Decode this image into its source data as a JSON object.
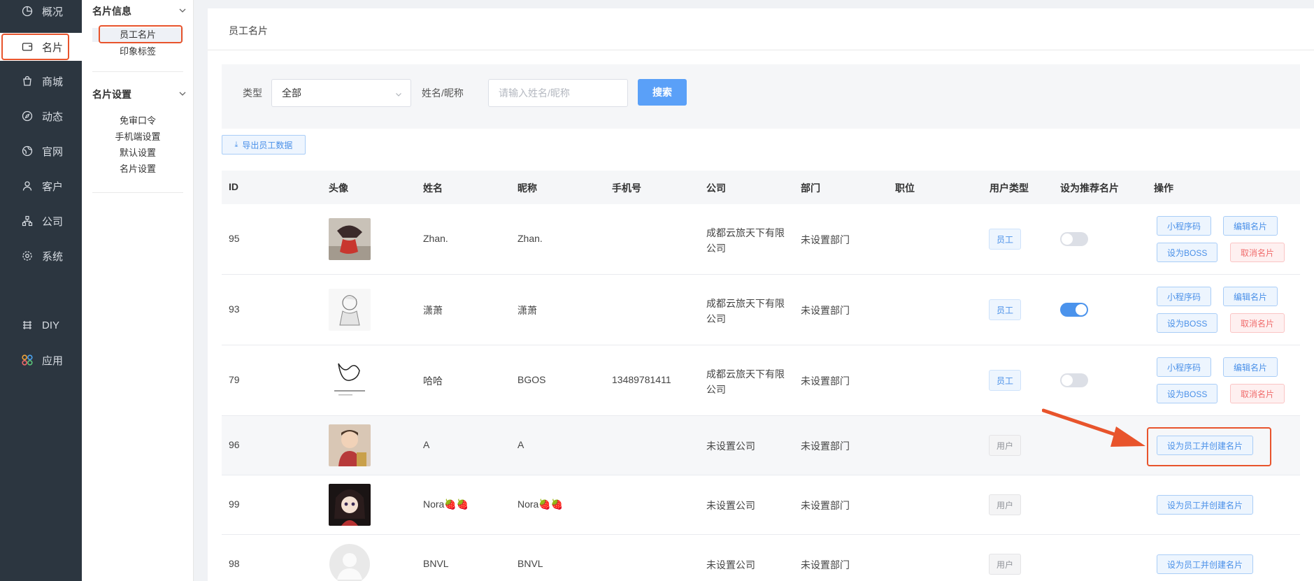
{
  "sidebar": {
    "items": [
      {
        "label": "概况",
        "icon": "pie-chart-icon"
      },
      {
        "label": "名片",
        "icon": "card-icon"
      },
      {
        "label": "商城",
        "icon": "shopping-bag-icon"
      },
      {
        "label": "动态",
        "icon": "compass-icon"
      },
      {
        "label": "官网",
        "icon": "globe-icon"
      },
      {
        "label": "客户",
        "icon": "user-icon"
      },
      {
        "label": "公司",
        "icon": "org-chart-icon"
      },
      {
        "label": "系统",
        "icon": "gear-icon"
      },
      {
        "label": "DIY",
        "icon": "layers-icon"
      },
      {
        "label": "应用",
        "icon": "apps-grid-icon"
      }
    ],
    "active": "名片"
  },
  "submenu": {
    "section1": {
      "title": "名片信息",
      "items": [
        "员工名片",
        "印象标签"
      ]
    },
    "section2": {
      "title": "名片设置",
      "items": [
        "免审口令",
        "手机端设置",
        "默认设置",
        "名片设置"
      ]
    },
    "active": "员工名片"
  },
  "page": {
    "title": "员工名片"
  },
  "filter": {
    "type_label": "类型",
    "type_value": "全部",
    "name_label": "姓名/昵称",
    "name_placeholder": "请输入姓名/昵称",
    "search_label": "搜索"
  },
  "export_label": "导出员工数据",
  "table": {
    "headers": [
      "ID",
      "头像",
      "姓名",
      "昵称",
      "手机号",
      "公司",
      "部门",
      "职位",
      "用户类型",
      "设为推荐名片",
      "操作"
    ],
    "rows": [
      {
        "id": "95",
        "name": "Zhan.",
        "nickname": "Zhan.",
        "phone": "",
        "company": "成都云旅天下有限公司",
        "company_l1": "成都云旅天下有限",
        "company_l2": "公司",
        "dept": "未设置部门",
        "position": "",
        "type": "员工",
        "recommend": false,
        "actions": [
          "小程序码",
          "编辑名片",
          "设为BOSS",
          "取消名片"
        ]
      },
      {
        "id": "93",
        "name": "潇萧",
        "nickname": "潇萧",
        "phone": "",
        "company": "成都云旅天下有限公司",
        "company_l1": "成都云旅天下有限",
        "company_l2": "公司",
        "dept": "未设置部门",
        "position": "",
        "type": "员工",
        "recommend": true,
        "actions": [
          "小程序码",
          "编辑名片",
          "设为BOSS",
          "取消名片"
        ]
      },
      {
        "id": "79",
        "name": "哈哈",
        "nickname": "BGOS",
        "phone": "13489781411",
        "company": "成都云旅天下有限公司",
        "company_l1": "成都云旅天下有限",
        "company_l2": "公司",
        "dept": "未设置部门",
        "position": "",
        "type": "员工",
        "recommend": false,
        "actions": [
          "小程序码",
          "编辑名片",
          "设为BOSS",
          "取消名片"
        ]
      },
      {
        "id": "96",
        "name": "A",
        "nickname": "A",
        "phone": "",
        "company": "未设置公司",
        "dept": "未设置部门",
        "position": "",
        "type": "用户",
        "action": "设为员工并创建名片"
      },
      {
        "id": "99",
        "name": "Nora🍓🍓",
        "nickname": "Nora🍓🍓",
        "phone": "",
        "company": "未设置公司",
        "dept": "未设置部门",
        "position": "",
        "type": "用户",
        "action": "设为员工并创建名片"
      },
      {
        "id": "98",
        "name": "BNVL",
        "nickname": "BNVL",
        "phone": "",
        "company": "未设置公司",
        "dept": "未设置部门",
        "position": "",
        "type": "用户",
        "action": "设为员工并创建名片"
      }
    ]
  },
  "colors": {
    "sidebar_bg": "#2c3640",
    "primary": "#5aa0f8",
    "annotation": "#e8542c",
    "danger": "#f06c6c"
  }
}
